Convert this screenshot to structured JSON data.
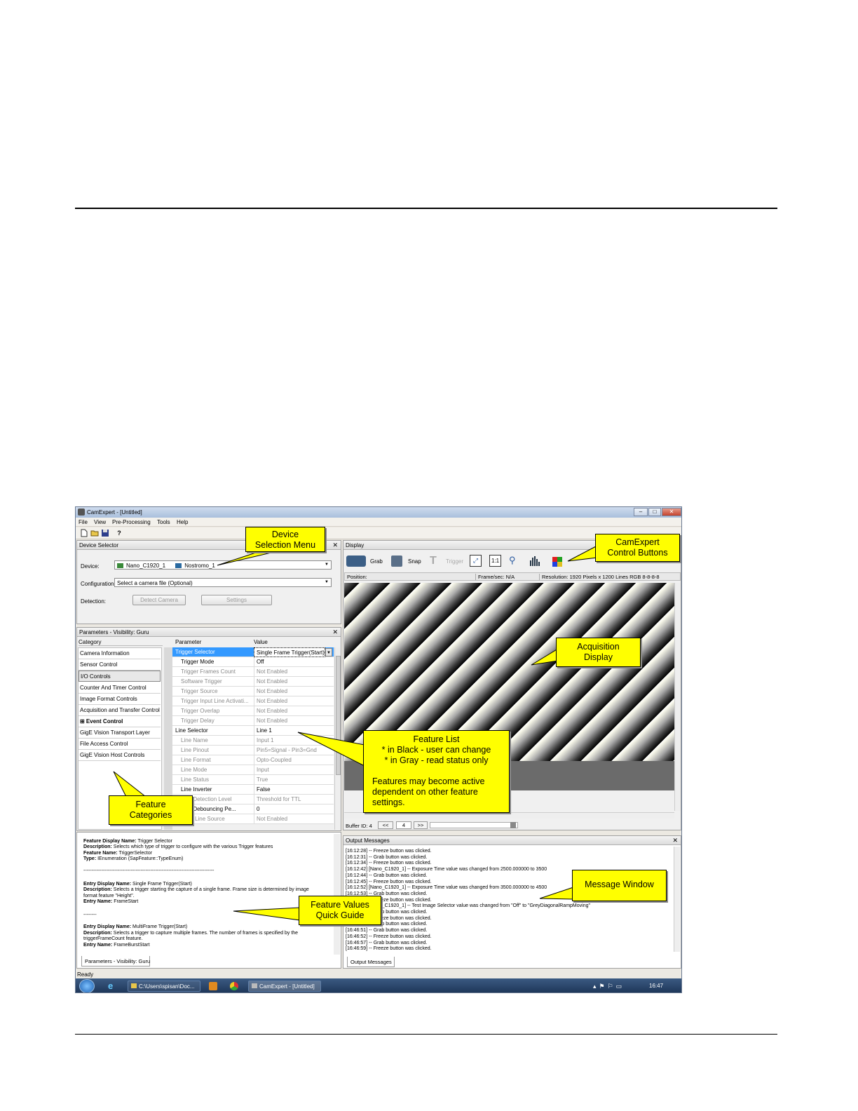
{
  "window": {
    "title": "CamExpert - [Untitled]",
    "min": "–",
    "max": "□",
    "close": "✕"
  },
  "menu": [
    "File",
    "View",
    "Pre-Processing",
    "Tools",
    "Help"
  ],
  "toolbar_icons": [
    "new-file-icon",
    "open-folder-icon",
    "save-icon",
    "help-icon"
  ],
  "device_selector": {
    "title": "Device Selector",
    "device_label": "Device:",
    "device_value": "Nano_C1920_1",
    "device_value2": "Nostromo_1",
    "config_label": "Configuration:",
    "config_value": "Select a camera file (Optional)",
    "detection_label": "Detection:",
    "detect_btn": "Detect Camera",
    "settings_btn": "Settings"
  },
  "parameters": {
    "title": "Parameters - Visibility: Guru",
    "category_header": "Category",
    "parameter_header": "Parameter",
    "value_header": "Value",
    "tab": "Parameters - Visibility: Guru",
    "categories": [
      "Camera Information",
      "Sensor Control",
      "I/O Controls",
      "Counter And Timer Control",
      "Image Format Controls",
      "Acquisition and Transfer Control",
      "⊞ Event Control",
      "GigE Vision Transport Layer",
      "File Access Control",
      "GigE Vision Host Controls"
    ],
    "rows": [
      {
        "name": "Trigger Selector",
        "value": "Single Frame Trigger(Start)"
      },
      {
        "name": "Trigger Mode",
        "value": "Off"
      },
      {
        "name": "Trigger Frames Count",
        "value": "Not Enabled"
      },
      {
        "name": "Software Trigger",
        "value": "Not Enabled"
      },
      {
        "name": "Trigger Source",
        "value": "Not Enabled"
      },
      {
        "name": "Trigger Input Line Activati...",
        "value": "Not Enabled"
      },
      {
        "name": "Trigger Overlap",
        "value": "Not Enabled"
      },
      {
        "name": "Trigger Delay",
        "value": "Not Enabled"
      },
      {
        "name": "Line Selector",
        "value": "Line 1"
      },
      {
        "name": "Line Name",
        "value": "Input 1"
      },
      {
        "name": "Line Pinout",
        "value": "Pin5=Signal - Pin3=Gnd"
      },
      {
        "name": "Line Format",
        "value": "Opto-Coupled"
      },
      {
        "name": "Line Mode",
        "value": "Input"
      },
      {
        "name": "Line Status",
        "value": "True"
      },
      {
        "name": "Line Inverter",
        "value": "False"
      },
      {
        "name": "Line Detection Level",
        "value": "Threshold for TTL"
      },
      {
        "name": "Line Debouncing Pe...",
        "value": "0"
      },
      {
        "name": "Input Line Source",
        "value": "Not Enabled"
      }
    ]
  },
  "description": {
    "l1b": "Feature Display Name:",
    "l1": "Trigger Selector",
    "l2b": "Description:",
    "l2": "Selects which type of trigger to configure with the various Trigger features",
    "l3b": "Feature Name:",
    "l3": "TriggerSelector",
    "l4b": "Type:",
    "l4": "IEnumeration (SapFeature::TypeEnum)",
    "sep": "--------------------------------------------------------------------------------",
    "l5b": "Entry Display Name:",
    "l5": "Single Frame Trigger(Start)",
    "l6b": "Description:",
    "l6": "Selects a trigger starting the capture of a single frame. Frame size is determined by image",
    "l6c": "format feature \"Height\".",
    "l7b": "Entry Name:",
    "l7": "FrameStart",
    "sep2": "--------",
    "l8b": "Entry Display Name:",
    "l8": "MultiFrame Trigger(Start)",
    "l9b": "Description:",
    "l9": "Selects a trigger to capture multiple frames. The number of frames is specified by the",
    "l9c": "triggerFrameCount feature.",
    "l10b": "Entry Name:",
    "l10": "FrameBurstStart"
  },
  "display": {
    "title": "Display",
    "grab": "Grab",
    "snap": "Snap",
    "trigger": "Trigger",
    "one_to_one": "1:1",
    "position": "Position:",
    "fps": "Frame/sec: N/A",
    "resolution": "Resolution: 1920 Pixels x 1200 Lines  RGB 8-8-8-8",
    "buffer_id": "Buffer ID: 4",
    "prev": "<<",
    "buffer_num": "4",
    "next": ">>"
  },
  "output": {
    "title": "Output Messages",
    "tab": "Output Messages",
    "messages": [
      "[16:12:28] -- Freeze button was clicked.",
      "[16:12:31] -- Grab button was clicked.",
      "[16:12:34] -- Freeze button was clicked.",
      "[16:12:42] [Nano_C1920_1] -- Exposure Time value was changed from 2500.000000 to 3500",
      "[16:12:44] -- Grab button was clicked.",
      "[16:12:45] -- Freeze button was clicked.",
      "[16:12:52] [Nano_C1920_1] -- Exposure Time value was changed from 3500.000000 to 4500",
      "[16:12:53] -- Grab button was clicked.",
      "[16:12:54] -- Freeze button was clicked.",
      "[16:12:58] [Nano_C1920_1] -- Test Image Selector value was changed from \"Off\" to \"GreyDiagonalRampMoving\"",
      "[16:13:01] -- Grab button was clicked.",
      "[16:13:05] -- Freeze button was clicked.",
      "[16:46:49] -- Grab button was clicked.",
      "[16:46:51] -- Grab button was clicked.",
      "[16:46:52] -- Freeze button was clicked.",
      "[16:46:57] -- Grab button was clicked.",
      "[16:46:59] -- Freeze button was clicked."
    ]
  },
  "status": "Ready",
  "taskbar": {
    "explorer": "C:\\Users\\spisan\\Doc...",
    "camexpert": "CamExpert - [Untitled]",
    "clock": "16:47"
  },
  "callouts": {
    "device_menu": "Device Selection Menu",
    "control_buttons": "CamExpert Control Buttons",
    "acq_display": "Acquisition Display",
    "feature_list_1": "Feature List",
    "feature_list_2": "* in Black - user can change",
    "feature_list_3": "* in Gray - read status only",
    "feature_list_4": "Features may become active",
    "feature_list_5": "dependent on other feature",
    "feature_list_6": "settings.",
    "feature_categories": "Feature Categories",
    "quick_guide": "Feature Values Quick Guide",
    "message_window": "Message Window"
  },
  "colors": {
    "callout": "#ffff00",
    "selection": "#3399ff",
    "taskbar": "#1c3456"
  }
}
